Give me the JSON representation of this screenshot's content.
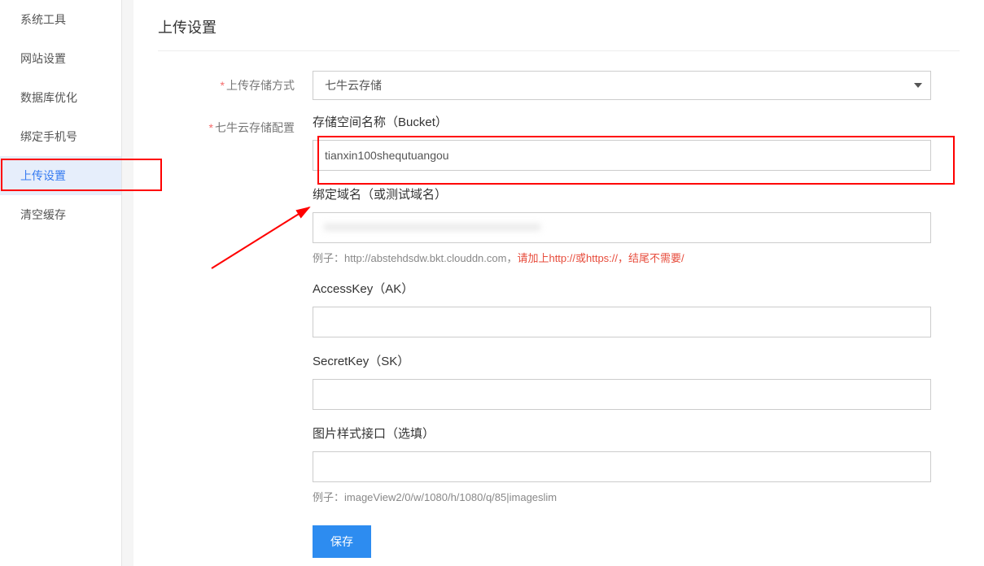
{
  "sidebar": {
    "items": [
      {
        "label": "系统工具",
        "active": false
      },
      {
        "label": "网站设置",
        "active": false
      },
      {
        "label": "数据库优化",
        "active": false
      },
      {
        "label": "绑定手机号",
        "active": false
      },
      {
        "label": "上传设置",
        "active": true
      },
      {
        "label": "清空缓存",
        "active": false
      }
    ]
  },
  "page": {
    "title": "上传设置"
  },
  "form": {
    "storage_method": {
      "label": "上传存储方式",
      "value": "七牛云存储"
    },
    "config_label": "七牛云存储配置",
    "bucket": {
      "label": "存储空间名称（Bucket）",
      "value": "tianxin100shequtuangou"
    },
    "domain": {
      "label": "绑定域名（或测试域名）",
      "value": "",
      "hint_prefix": "例子：http://abstehdsdw.bkt.clouddn.com，",
      "hint_red": "请加上http://或https://，结尾不需要/"
    },
    "access_key": {
      "label": "AccessKey（AK）",
      "value": ""
    },
    "secret_key": {
      "label": "SecretKey（SK）",
      "value": ""
    },
    "image_style": {
      "label": "图片样式接口（选填）",
      "value": "",
      "hint": "例子：imageView2/0/w/1080/h/1080/q/85|imageslim"
    },
    "save_label": "保存"
  },
  "domain_blur_placeholder": "xxxxxxxxxxxxxxxxxxxxxxxxxxxxxxxxxxxxxx"
}
